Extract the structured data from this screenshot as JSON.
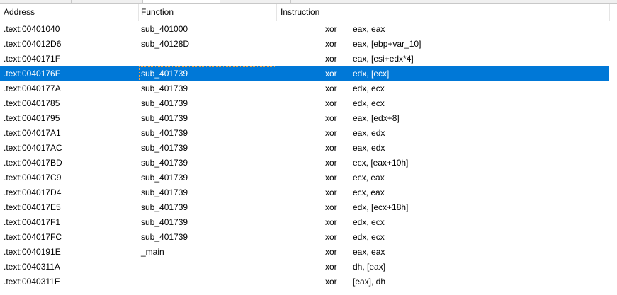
{
  "columns": {
    "address": "Address",
    "function": "Function",
    "instruction": "Instruction"
  },
  "selected_index": 3,
  "rows": [
    {
      "address": ".text:00401040",
      "function": "sub_401000",
      "mnemonic": "xor",
      "operands": "eax, eax"
    },
    {
      "address": ".text:004012D6",
      "function": "sub_40128D",
      "mnemonic": "xor",
      "operands": "eax, [ebp+var_10]"
    },
    {
      "address": ".text:0040171F",
      "function": "",
      "mnemonic": "xor",
      "operands": "eax, [esi+edx*4]"
    },
    {
      "address": ".text:0040176F",
      "function": "sub_401739",
      "mnemonic": "xor",
      "operands": "edx, [ecx]"
    },
    {
      "address": ".text:0040177A",
      "function": "sub_401739",
      "mnemonic": "xor",
      "operands": "edx, ecx"
    },
    {
      "address": ".text:00401785",
      "function": "sub_401739",
      "mnemonic": "xor",
      "operands": "edx, ecx"
    },
    {
      "address": ".text:00401795",
      "function": "sub_401739",
      "mnemonic": "xor",
      "operands": "eax, [edx+8]"
    },
    {
      "address": ".text:004017A1",
      "function": "sub_401739",
      "mnemonic": "xor",
      "operands": "eax, edx"
    },
    {
      "address": ".text:004017AC",
      "function": "sub_401739",
      "mnemonic": "xor",
      "operands": "eax, edx"
    },
    {
      "address": ".text:004017BD",
      "function": "sub_401739",
      "mnemonic": "xor",
      "operands": "ecx, [eax+10h]"
    },
    {
      "address": ".text:004017C9",
      "function": "sub_401739",
      "mnemonic": "xor",
      "operands": "ecx, eax"
    },
    {
      "address": ".text:004017D4",
      "function": "sub_401739",
      "mnemonic": "xor",
      "operands": "ecx, eax"
    },
    {
      "address": ".text:004017E5",
      "function": "sub_401739",
      "mnemonic": "xor",
      "operands": "edx, [ecx+18h]"
    },
    {
      "address": ".text:004017F1",
      "function": "sub_401739",
      "mnemonic": "xor",
      "operands": "edx, ecx"
    },
    {
      "address": ".text:004017FC",
      "function": "sub_401739",
      "mnemonic": "xor",
      "operands": "edx, ecx"
    },
    {
      "address": ".text:0040191E",
      "function": "_main",
      "mnemonic": "xor",
      "operands": "eax, eax"
    },
    {
      "address": ".text:0040311A",
      "function": "",
      "mnemonic": "xor",
      "operands": "dh, [eax]"
    },
    {
      "address": ".text:0040311E",
      "function": "",
      "mnemonic": "xor",
      "operands": "[eax], dh"
    }
  ]
}
